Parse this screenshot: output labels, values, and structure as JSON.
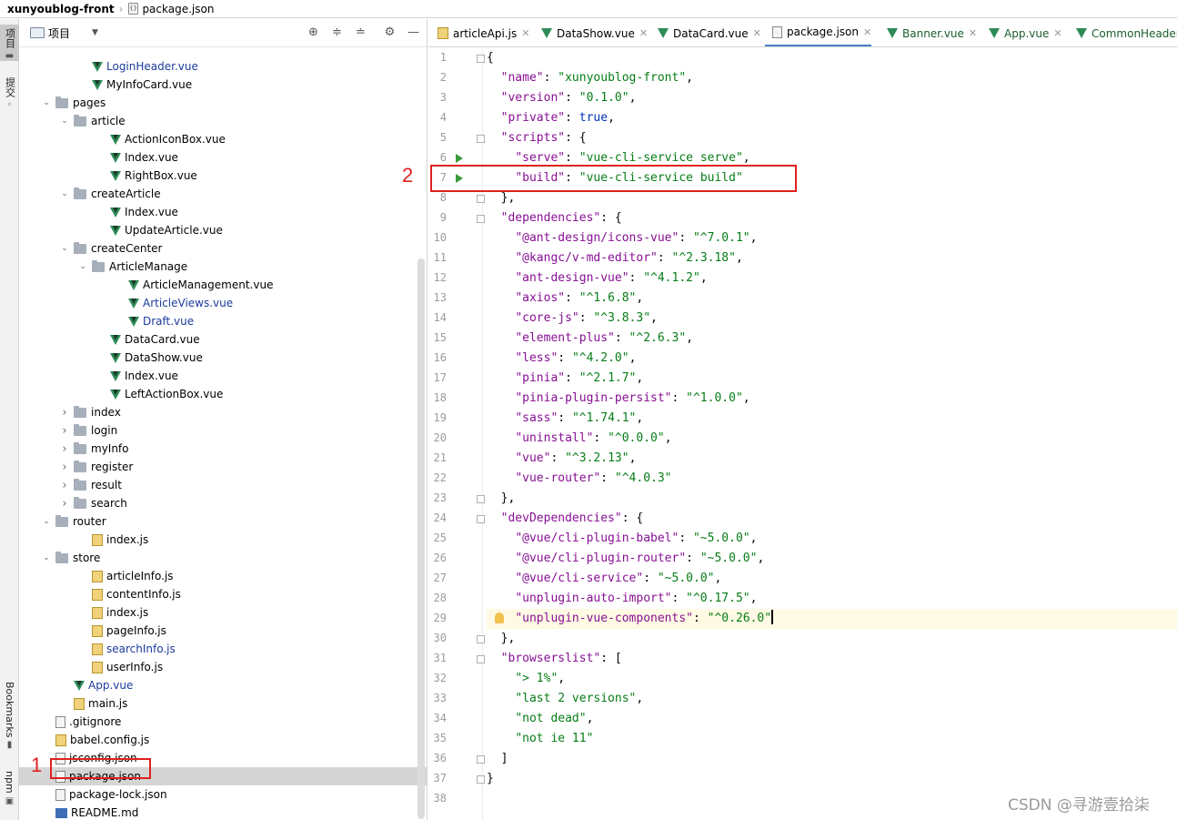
{
  "breadcrumb": {
    "project": "xunyoublog-front",
    "file": "package.json"
  },
  "toolstrip": {
    "project_tab": "项目",
    "commit_tab": "提交",
    "bookmarks_tab": "Bookmarks",
    "npm_tab": "npm"
  },
  "project_panel": {
    "title": "项目",
    "tools": [
      "target-icon",
      "expand-all-icon",
      "collapse-all-icon",
      "gear-icon",
      "minimize-icon"
    ],
    "tree": [
      {
        "label": "LoginHeader.vue",
        "kind": "vue",
        "depth": 4,
        "blue": true
      },
      {
        "label": "MyInfoCard.vue",
        "kind": "vue",
        "depth": 4
      },
      {
        "label": "pages",
        "kind": "folder",
        "depth": 2,
        "open": true
      },
      {
        "label": "article",
        "kind": "folder",
        "depth": 3,
        "open": true
      },
      {
        "label": "ActionIconBox.vue",
        "kind": "vue",
        "depth": 5
      },
      {
        "label": "Index.vue",
        "kind": "vue",
        "depth": 5
      },
      {
        "label": "RightBox.vue",
        "kind": "vue",
        "depth": 5
      },
      {
        "label": "createArticle",
        "kind": "folder",
        "depth": 3,
        "open": true
      },
      {
        "label": "Index.vue",
        "kind": "vue",
        "depth": 5
      },
      {
        "label": "UpdateArticle.vue",
        "kind": "vue",
        "depth": 5
      },
      {
        "label": "createCenter",
        "kind": "folder",
        "depth": 3,
        "open": true
      },
      {
        "label": "ArticleManage",
        "kind": "folder",
        "depth": 4,
        "open": true
      },
      {
        "label": "ArticleManagement.vue",
        "kind": "vue",
        "depth": 6
      },
      {
        "label": "ArticleViews.vue",
        "kind": "vue",
        "depth": 6,
        "blue": true
      },
      {
        "label": "Draft.vue",
        "kind": "vue",
        "depth": 6,
        "blue": true
      },
      {
        "label": "DataCard.vue",
        "kind": "vue",
        "depth": 5
      },
      {
        "label": "DataShow.vue",
        "kind": "vue",
        "depth": 5
      },
      {
        "label": "Index.vue",
        "kind": "vue",
        "depth": 5
      },
      {
        "label": "LeftActionBox.vue",
        "kind": "vue",
        "depth": 5
      },
      {
        "label": "index",
        "kind": "folder",
        "depth": 3,
        "open": false
      },
      {
        "label": "login",
        "kind": "folder",
        "depth": 3,
        "open": false
      },
      {
        "label": "myInfo",
        "kind": "folder",
        "depth": 3,
        "open": false
      },
      {
        "label": "register",
        "kind": "folder",
        "depth": 3,
        "open": false
      },
      {
        "label": "result",
        "kind": "folder",
        "depth": 3,
        "open": false
      },
      {
        "label": "search",
        "kind": "folder",
        "depth": 3,
        "open": false
      },
      {
        "label": "router",
        "kind": "folder",
        "depth": 2,
        "open": true
      },
      {
        "label": "index.js",
        "kind": "js",
        "depth": 4
      },
      {
        "label": "store",
        "kind": "folder",
        "depth": 2,
        "open": true
      },
      {
        "label": "articleInfo.js",
        "kind": "js",
        "depth": 4
      },
      {
        "label": "contentInfo.js",
        "kind": "js",
        "depth": 4
      },
      {
        "label": "index.js",
        "kind": "js",
        "depth": 4
      },
      {
        "label": "pageInfo.js",
        "kind": "js",
        "depth": 4
      },
      {
        "label": "searchInfo.js",
        "kind": "js",
        "depth": 4,
        "blue": true
      },
      {
        "label": "userInfo.js",
        "kind": "js",
        "depth": 4
      },
      {
        "label": "App.vue",
        "kind": "vue",
        "depth": 3,
        "blue": true
      },
      {
        "label": "main.js",
        "kind": "js",
        "depth": 3
      },
      {
        "label": ".gitignore",
        "kind": "txt",
        "depth": 2
      },
      {
        "label": "babel.config.js",
        "kind": "js",
        "depth": 2
      },
      {
        "label": "jsconfig.json",
        "kind": "json",
        "depth": 2
      },
      {
        "label": "package.json",
        "kind": "json",
        "depth": 2,
        "selected": true
      },
      {
        "label": "package-lock.json",
        "kind": "json",
        "depth": 2
      },
      {
        "label": "README.md",
        "kind": "md",
        "depth": 2
      }
    ]
  },
  "annotations": {
    "marker1": "1",
    "marker2": "2"
  },
  "editor": {
    "tabs": [
      {
        "label": "articleApi.js",
        "kind": "js"
      },
      {
        "label": "DataShow.vue",
        "kind": "vue"
      },
      {
        "label": "DataCard.vue",
        "kind": "vue"
      },
      {
        "label": "package.json",
        "kind": "json",
        "active": true
      },
      {
        "label": "Banner.vue",
        "kind": "vue",
        "green": true
      },
      {
        "label": "App.vue",
        "kind": "vue",
        "green": true
      },
      {
        "label": "CommonHeader",
        "kind": "vue",
        "green": true
      }
    ],
    "current_line": 29,
    "run_lines": [
      6,
      7
    ],
    "lines": [
      {
        "n": "1",
        "html": "<span class='p'>{</span>"
      },
      {
        "n": "2",
        "html": "  <span class='k'>\"name\"</span>: <span class='s'>\"xunyoublog-front\"</span>,"
      },
      {
        "n": "3",
        "html": "  <span class='k'>\"version\"</span>: <span class='s'>\"0.1.0\"</span>,"
      },
      {
        "n": "4",
        "html": "  <span class='k'>\"private\"</span>: <span class='kw'>true</span>,"
      },
      {
        "n": "5",
        "html": "  <span class='k'>\"scripts\"</span>: {"
      },
      {
        "n": "6",
        "html": "    <span class='k'>\"serve\"</span>: <span class='s'>\"vue-cli-service serve\"</span>,"
      },
      {
        "n": "7",
        "html": "    <span class='k'>\"build\"</span>: <span class='s'>\"vue-cli-service build\"</span>"
      },
      {
        "n": "8",
        "html": "  },"
      },
      {
        "n": "9",
        "html": "  <span class='k'>\"dependencies\"</span>: {"
      },
      {
        "n": "10",
        "html": "    <span class='k'>\"@ant-design/icons-vue\"</span>: <span class='s'>\"^7.0.1\"</span>,"
      },
      {
        "n": "11",
        "html": "    <span class='k'>\"@kangc/v-md-editor\"</span>: <span class='s'>\"^2.3.18\"</span>,"
      },
      {
        "n": "12",
        "html": "    <span class='k'>\"ant-design-vue\"</span>: <span class='s'>\"^4.1.2\"</span>,"
      },
      {
        "n": "13",
        "html": "    <span class='k'>\"axios\"</span>: <span class='s'>\"^1.6.8\"</span>,"
      },
      {
        "n": "14",
        "html": "    <span class='k'>\"core-js\"</span>: <span class='s'>\"^3.8.3\"</span>,"
      },
      {
        "n": "15",
        "html": "    <span class='k'>\"element-plus\"</span>: <span class='s'>\"^2.6.3\"</span>,"
      },
      {
        "n": "16",
        "html": "    <span class='k'>\"less\"</span>: <span class='s'>\"^4.2.0\"</span>,"
      },
      {
        "n": "17",
        "html": "    <span class='k'>\"pinia\"</span>: <span class='s'>\"^2.1.7\"</span>,"
      },
      {
        "n": "18",
        "html": "    <span class='k'>\"pinia-plugin-persist\"</span>: <span class='s'>\"^1.0.0\"</span>,"
      },
      {
        "n": "19",
        "html": "    <span class='k'>\"sass\"</span>: <span class='s'>\"^1.74.1\"</span>,"
      },
      {
        "n": "20",
        "html": "    <span class='k'>\"uninstall\"</span>: <span class='s'>\"^0.0.0\"</span>,"
      },
      {
        "n": "21",
        "html": "    <span class='k'>\"vue\"</span>: <span class='s'>\"^3.2.13\"</span>,"
      },
      {
        "n": "22",
        "html": "    <span class='k'>\"vue-router\"</span>: <span class='s'>\"^4.0.3\"</span>"
      },
      {
        "n": "23",
        "html": "  },"
      },
      {
        "n": "24",
        "html": "  <span class='k'>\"devDependencies\"</span>: {"
      },
      {
        "n": "25",
        "html": "    <span class='k'>\"@vue/cli-plugin-babel\"</span>: <span class='s'>\"~5.0.0\"</span>,"
      },
      {
        "n": "26",
        "html": "    <span class='k'>\"@vue/cli-plugin-router\"</span>: <span class='s'>\"~5.0.0\"</span>,"
      },
      {
        "n": "27",
        "html": "    <span class='k'>\"@vue/cli-service\"</span>: <span class='s'>\"~5.0.0\"</span>,"
      },
      {
        "n": "28",
        "html": "    <span class='k'>\"unplugin-auto-import\"</span>: <span class='s'>\"^0.17.5\"</span>,"
      },
      {
        "n": "29",
        "html": "    <span class='k'>\"unplugin-vue-components\"</span>: <span class='s'>\"^0.26.0\"</span><span class='caret'></span>"
      },
      {
        "n": "30",
        "html": "  },"
      },
      {
        "n": "31",
        "html": "  <span class='k'>\"browserslist\"</span>: ["
      },
      {
        "n": "32",
        "html": "    <span class='s'>\"&gt; 1%\"</span>,"
      },
      {
        "n": "33",
        "html": "    <span class='s'>\"last 2 versions\"</span>,"
      },
      {
        "n": "34",
        "html": "    <span class='s'>\"not dead\"</span>,"
      },
      {
        "n": "35",
        "html": "    <span class='s'>\"not ie 11\"</span>"
      },
      {
        "n": "36",
        "html": "  ]"
      },
      {
        "n": "37",
        "html": "}"
      },
      {
        "n": "38",
        "html": ""
      }
    ]
  },
  "watermark": "CSDN @寻游壹拾柒"
}
